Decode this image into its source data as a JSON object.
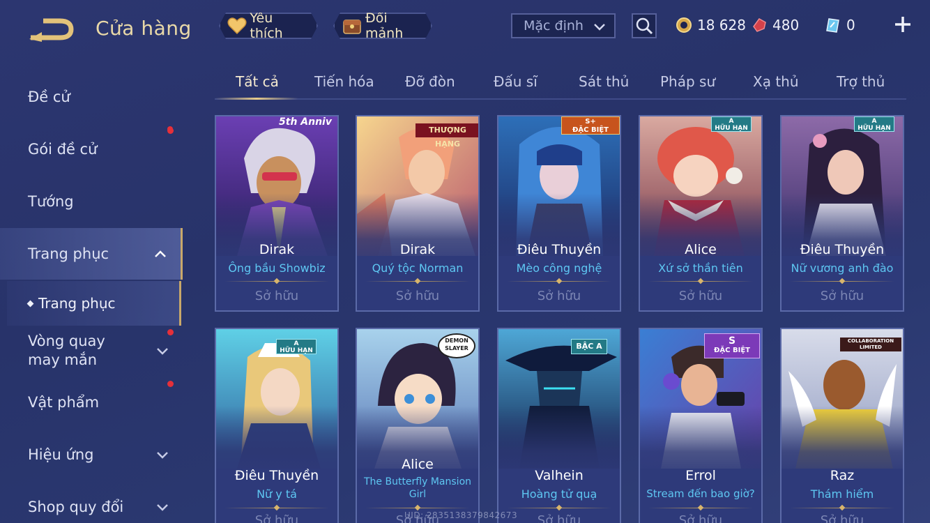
{
  "header": {
    "title": "Cửa hàng",
    "favorites_label": "Yêu thích",
    "exchange_label": "Đổi mảnh",
    "sort_select": "Mặc định",
    "gold": "18 628",
    "vouchers": "480",
    "tickets": "0"
  },
  "sidebar": {
    "items": [
      {
        "label": "Đề cử"
      },
      {
        "label": "Gói đề cử"
      },
      {
        "label": "Tướng"
      },
      {
        "label": "Trang phục"
      },
      {
        "label": "Trang phục"
      },
      {
        "label": "Vòng quay may mắn"
      },
      {
        "label": "Vật phẩm"
      },
      {
        "label": "Hiệu ứng"
      },
      {
        "label": "Shop quy đổi"
      }
    ]
  },
  "tabs": [
    "Tất cả",
    "Tiến hóa",
    "Đỡ đòn",
    "Đấu sĩ",
    "Sát thủ",
    "Pháp sư",
    "Xạ thủ",
    "Trợ thủ"
  ],
  "cards": [
    {
      "hero": "Dirak",
      "skin": "Ông bầu Showbiz",
      "status": "Sở hữu",
      "badge": "5th Anniv"
    },
    {
      "hero": "Dirak",
      "skin": "Quý tộc Norman",
      "status": "Sở hữu",
      "badge": "THƯỢNG HẠNG"
    },
    {
      "hero": "Điêu Thuyền",
      "skin": "Mèo công nghệ",
      "status": "Sở hữu",
      "badge": "S+",
      "badge_sub": "ĐẶC BIỆT"
    },
    {
      "hero": "Alice",
      "skin": "Xứ sở thần tiên",
      "status": "Sở hữu",
      "badge": "A",
      "badge_sub": "HỮU HẠN"
    },
    {
      "hero": "Điêu Thuyền",
      "skin": "Nữ vương anh đào",
      "status": "Sở hữu",
      "badge": "A",
      "badge_sub": "HỮU HẠN"
    },
    {
      "hero": "Điêu Thuyền",
      "skin": "Nữ y tá",
      "status": "Sở hữu",
      "badge": "A",
      "badge_sub": "HỮU HẠN"
    },
    {
      "hero": "Alice",
      "skin": "The Butterfly Mansion Girl",
      "status": "Sở hữu",
      "badge": "DEMON SLAYER"
    },
    {
      "hero": "Valhein",
      "skin": "Hoàng tử quạ",
      "status": "Sở hữu",
      "badge": "BẬC A"
    },
    {
      "hero": "Errol",
      "skin": "Stream đến bao giờ?",
      "status": "Sở hữu",
      "badge": "S",
      "badge_sub": "ĐẶC BIỆT"
    },
    {
      "hero": "Raz",
      "skin": "Thám hiểm",
      "status": "Sở hữu",
      "badge": "COLLABORATION LIMITED"
    }
  ],
  "footer": {
    "uid": "UID: 2835138379842673"
  },
  "colors": {
    "accent_gold": "#e8cc8a",
    "skin_name": "#5ec7f2",
    "notify_dot": "#e5303a"
  }
}
